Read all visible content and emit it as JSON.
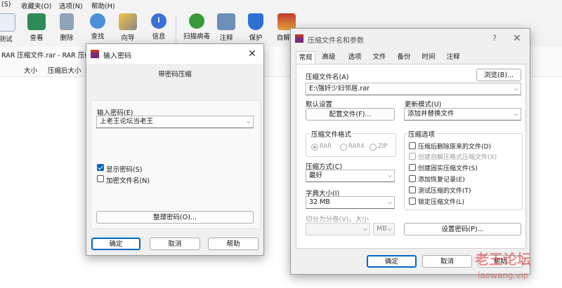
{
  "menu": {
    "items": [
      "(S)",
      "收藏夹(O)",
      "选项(N)",
      "帮助(H)"
    ]
  },
  "toolbar": {
    "buttons": [
      "测试",
      "查看",
      "删除",
      "查找",
      "向导",
      "信息",
      "扫描病毒",
      "注释",
      "保护",
      "自解压"
    ]
  },
  "address": {
    "text": "RAR 压缩文件.rar - RAR 压缩文件"
  },
  "columns": {
    "size": "大小",
    "packed": "压缩后大小"
  },
  "password_dialog": {
    "title": "输入密码",
    "heading": "带密码压缩",
    "input_label": "输入密码(E)",
    "input_value": "上老王论坛当老王",
    "show_password": "显示密码(S)",
    "encrypt_names": "加密文件名(N)",
    "organize_button": "整理密码(O)...",
    "ok": "确定",
    "cancel": "取消",
    "help": "帮助"
  },
  "archive_dialog": {
    "title": "压缩文件名和参数",
    "help_icon_text": "?",
    "tabs": [
      "常规",
      "高级",
      "选项",
      "文件",
      "备份",
      "时间",
      "注释"
    ],
    "archive_name_label": "压缩文件名(A)",
    "browse_button": "浏览(B)...",
    "archive_name_value": "E:\\强奸少妇邻居.rar",
    "default_settings_label": "默认设置",
    "profiles_button": "配置文件(F)...",
    "update_mode_label": "更新模式(U)",
    "update_mode_value": "添加并替换文件",
    "format_group": "压缩文件格式",
    "formats": [
      "RAR",
      "RAR4",
      "ZIP"
    ],
    "method_label": "压缩方式(C)",
    "method_value": "最好",
    "dict_label": "字典大小(I)",
    "dict_value": "32 MB",
    "split_label": "切分为分卷(V)，大小",
    "split_unit": "MB",
    "options_group": "压缩选项",
    "options": [
      "压缩后删除原来的文件(D)",
      "创建自解压格式压缩文件(X)",
      "创建固实压缩文件(S)",
      "添加恢复记录(E)",
      "测试压缩的文件(T)",
      "锁定压缩文件(L)"
    ],
    "set_password_button": "设置密码(P)...",
    "ok": "确定",
    "cancel": "取消",
    "help": "帮助"
  },
  "watermark": {
    "text": "老王论坛",
    "sub": "laowang.vip"
  }
}
